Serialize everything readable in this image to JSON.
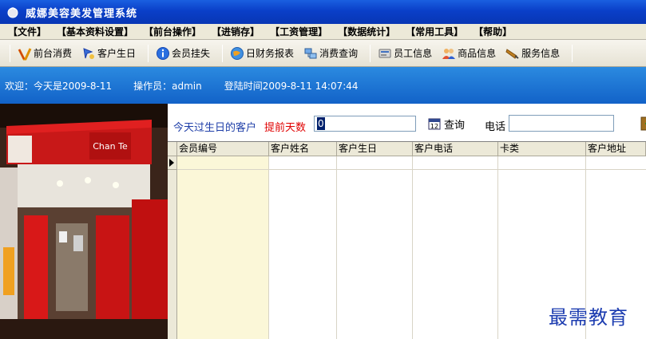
{
  "window": {
    "title": "威娜美容美发管理系统"
  },
  "menu": [
    "【文件】",
    "【基本资料设置】",
    "【前台操作】",
    "【进销存】",
    "【工资管理】",
    "【数据统计】",
    "【常用工具】",
    "【帮助】"
  ],
  "toolbar": {
    "front_sale": "前台消费",
    "customer_birthday": "客户生日",
    "member_loss": "会员挂失",
    "daily_finance": "日财务报表",
    "consume_query": "消费查询",
    "staff_info": "员工信息",
    "goods_info": "商品信息",
    "service_info": "服务信息"
  },
  "welcome": {
    "greeting": "欢迎：今天是2009-8-11",
    "operator": "操作员：admin",
    "login_time": "登陆时间2009-8-11 14:07:44"
  },
  "photo": {
    "sign_text": "Chan Te"
  },
  "search": {
    "today_label": "今天过生日的客户",
    "advance_days_label": "提前天数",
    "advance_days_value": "0",
    "query_label": "查询",
    "phone_label": "电话",
    "phone_value": ""
  },
  "grid": {
    "columns": [
      "会员编号",
      "客户姓名",
      "客户生日",
      "客户电话",
      "卡类",
      "客户地址"
    ],
    "rows": []
  },
  "watermark": "最需教育",
  "colors": {
    "title_bar": "#0a3fc8",
    "welcome_bar": "#1a70d4",
    "highlight_red": "#e00000",
    "link_blue": "#1e3ea8"
  }
}
